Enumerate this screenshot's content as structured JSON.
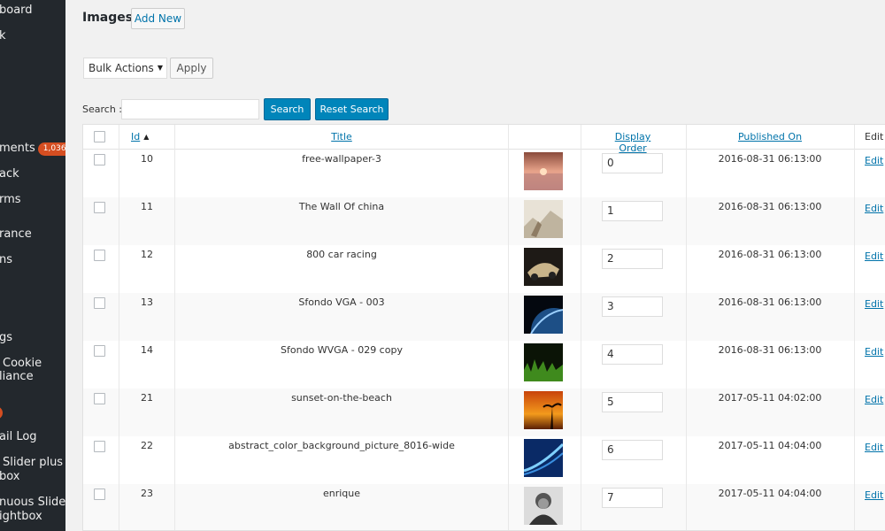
{
  "sidebar": {
    "items": [
      {
        "label": "board"
      },
      {
        "label": "k"
      },
      {
        "label": "ments",
        "badge": "1,036"
      },
      {
        "label": "ack"
      },
      {
        "label": "rms"
      },
      {
        "label": "rance"
      },
      {
        "label": "ns"
      },
      {
        "label": "gs"
      },
      {
        "label": "Cookie"
      },
      {
        "label": "liance"
      },
      {
        "label": "",
        "badge": "2"
      },
      {
        "label": "ail Log"
      },
      {
        "label": "Slider plus"
      },
      {
        "label": "box"
      },
      {
        "label": "nuous Slider"
      },
      {
        "label": "ightbox"
      }
    ]
  },
  "header": {
    "title": "Images",
    "add_new_label": "Add New"
  },
  "bulk": {
    "selected": "Bulk Actions",
    "apply_label": "Apply"
  },
  "search": {
    "label": "Search :",
    "value": "",
    "search_label": "Search",
    "reset_label": "Reset Search"
  },
  "table": {
    "headers": {
      "id": "Id",
      "title": "Title",
      "display_order": "Display Order",
      "published_on": "Published On",
      "edit": "Edit"
    },
    "rows": [
      {
        "id": "10",
        "title": "free-wallpaper-3",
        "order": "0",
        "published": "2016-08-31 06:13:00",
        "edit": "Edit",
        "thumb": "pink-sunset-thumbnail"
      },
      {
        "id": "11",
        "title": "The Wall Of china",
        "order": "1",
        "published": "2016-08-31 06:13:00",
        "edit": "Edit",
        "thumb": "great-wall-thumbnail"
      },
      {
        "id": "12",
        "title": "800 car racing",
        "order": "2",
        "published": "2016-08-31 06:13:00",
        "edit": "Edit",
        "thumb": "car-racing-thumbnail"
      },
      {
        "id": "13",
        "title": "Sfondo VGA - 003",
        "order": "3",
        "published": "2016-08-31 06:13:00",
        "edit": "Edit",
        "thumb": "earth-space-thumbnail"
      },
      {
        "id": "14",
        "title": "Sfondo WVGA - 029 copy",
        "order": "4",
        "published": "2016-08-31 06:13:00",
        "edit": "Edit",
        "thumb": "green-grass-thumbnail"
      },
      {
        "id": "21",
        "title": "sunset-on-the-beach",
        "order": "5",
        "published": "2017-05-11 04:02:00",
        "edit": "Edit",
        "thumb": "beach-sunset-thumbnail"
      },
      {
        "id": "22",
        "title": "abstract_color_background_picture_8016-wide",
        "order": "6",
        "published": "2017-05-11 04:04:00",
        "edit": "Edit",
        "thumb": "abstract-blue-thumbnail"
      },
      {
        "id": "23",
        "title": "enrique",
        "order": "7",
        "published": "2017-05-11 04:04:00",
        "edit": "Edit",
        "thumb": "portrait-thumbnail"
      }
    ]
  },
  "colors": {
    "sidebar_bg": "#23282d",
    "link": "#0073aa",
    "primary_button": "#0085ba",
    "badge": "#d54e21"
  }
}
